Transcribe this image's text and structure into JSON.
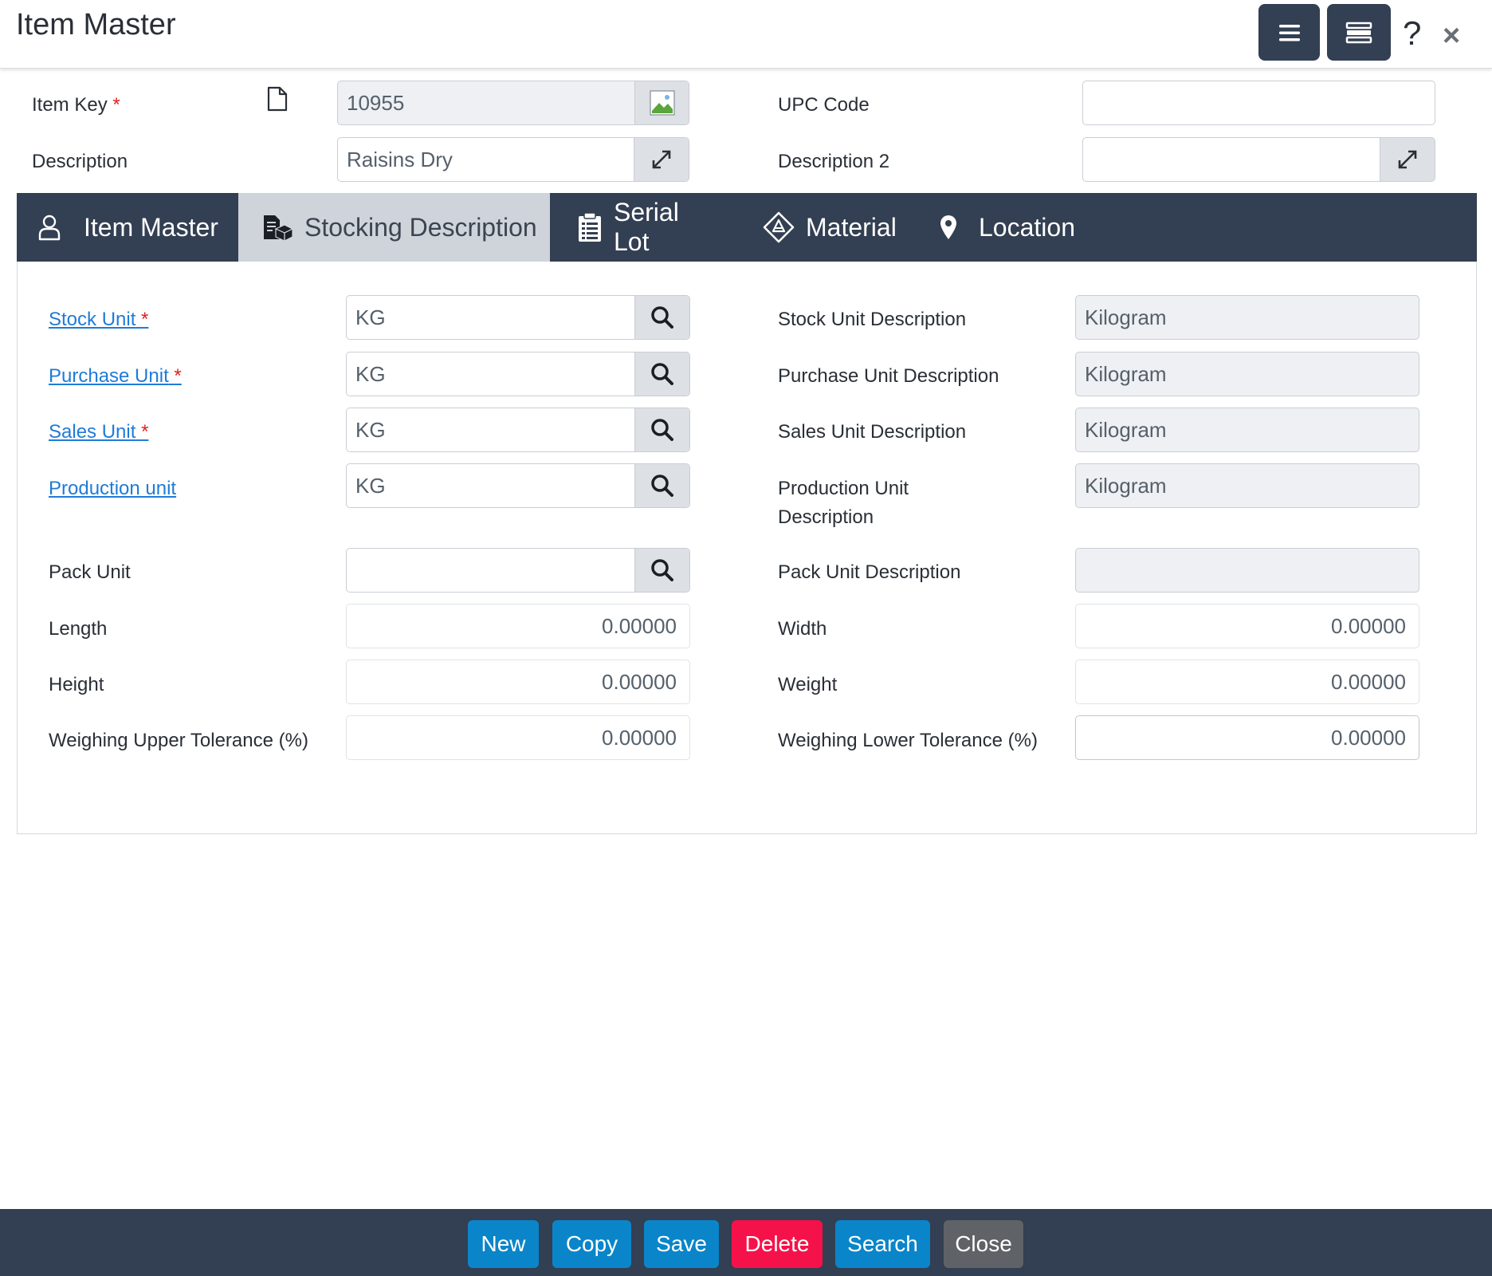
{
  "window": {
    "title": "Item Master",
    "help_label": "?",
    "close_label": "×"
  },
  "header_fields": {
    "item_key": {
      "label": "Item Key",
      "required": "*",
      "value": "10955"
    },
    "description": {
      "label": "Description",
      "value": "Raisins Dry"
    },
    "upc_code": {
      "label": "UPC Code",
      "value": ""
    },
    "description2": {
      "label": "Description 2",
      "value": ""
    }
  },
  "tabs": [
    {
      "label": "Item Master",
      "icon": "user-icon",
      "active": false
    },
    {
      "label": "Stocking Description",
      "icon": "boxes-icon",
      "active": true
    },
    {
      "label": "Serial Lot",
      "icon": "clipboard-list-icon",
      "active": false
    },
    {
      "label": "Material",
      "icon": "diamond-icon",
      "active": false
    },
    {
      "label": "Location",
      "icon": "map-pin-icon",
      "active": false
    }
  ],
  "stocking": {
    "stock_unit": {
      "label": "Stock Unit",
      "required": "*",
      "value": "KG"
    },
    "purchase_unit": {
      "label": "Purchase Unit",
      "required": "*",
      "value": "KG"
    },
    "sales_unit": {
      "label": "Sales Unit",
      "required": "*",
      "value": "KG"
    },
    "production_unit": {
      "label": "Production unit",
      "value": "KG"
    },
    "pack_unit": {
      "label": "Pack Unit",
      "value": ""
    },
    "length": {
      "label": "Length",
      "value": "0.00000"
    },
    "height": {
      "label": "Height",
      "value": "0.00000"
    },
    "weighing_upper": {
      "label": "Weighing Upper Tolerance (%)",
      "value": "0.00000"
    },
    "stock_unit_desc": {
      "label": "Stock Unit Description",
      "value": "Kilogram"
    },
    "purchase_unit_desc": {
      "label": "Purchase Unit Description",
      "value": "Kilogram"
    },
    "sales_unit_desc": {
      "label": "Sales Unit Description",
      "value": "Kilogram"
    },
    "production_unit_desc": {
      "label": "Production Unit Description",
      "value": "Kilogram"
    },
    "pack_unit_desc": {
      "label": "Pack Unit Description",
      "value": ""
    },
    "width": {
      "label": "Width",
      "value": "0.00000"
    },
    "weight": {
      "label": "Weight",
      "value": "0.00000"
    },
    "weighing_lower": {
      "label": "Weighing Lower Tolerance (%)",
      "value": "0.00000"
    }
  },
  "footer": {
    "new": "New",
    "copy": "Copy",
    "save": "Save",
    "delete": "Delete",
    "search": "Search",
    "close": "Close"
  },
  "colors": {
    "header_dark": "#333f52",
    "primary_button": "#0a85c9",
    "delete_button": "#f5124a",
    "close_button": "#5f6368",
    "link": "#1f7bd8",
    "active_tab": "#cfd4db"
  }
}
